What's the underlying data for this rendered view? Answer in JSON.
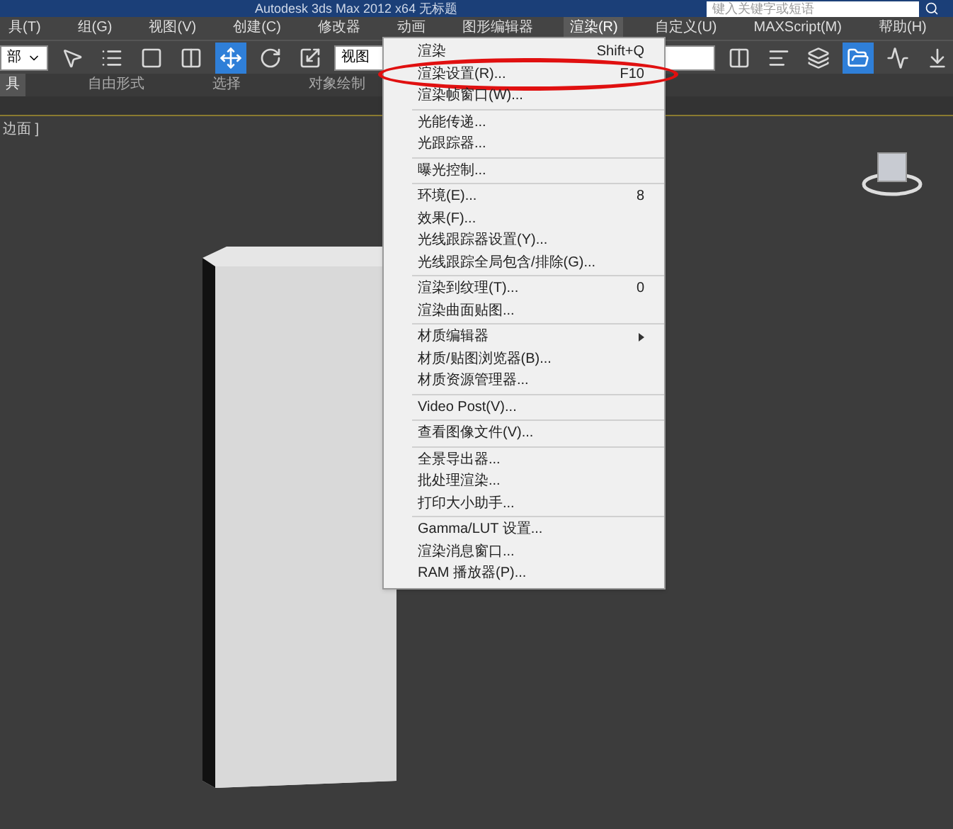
{
  "title_bar": {
    "title": "Autodesk 3ds Max  2012 x64  无标题",
    "search_placeholder": "键入关键字或短语"
  },
  "menu_bar": [
    {
      "label": "具(T)",
      "selected": false
    },
    {
      "label": "组(G)",
      "selected": false
    },
    {
      "label": "视图(V)",
      "selected": false
    },
    {
      "label": "创建(C)",
      "selected": false
    },
    {
      "label": "修改器",
      "selected": false
    },
    {
      "label": "动画",
      "selected": false
    },
    {
      "label": "图形编辑器",
      "selected": false
    },
    {
      "label": "渲染(R)",
      "selected": true
    },
    {
      "label": "自定义(U)",
      "selected": false
    },
    {
      "label": "MAXScript(M)",
      "selected": false
    },
    {
      "label": "帮助(H)",
      "selected": false
    }
  ],
  "toolbar": {
    "selection_filter": "部",
    "reference_coordinate": "视图"
  },
  "ribbon_tabs": [
    {
      "label": "具",
      "selected": true
    },
    {
      "label": "自由形式",
      "selected": false
    },
    {
      "label": "选择",
      "selected": false
    },
    {
      "label": "对象绘制",
      "selected": false
    }
  ],
  "viewport": {
    "label": "边面 ]"
  },
  "render_menu": [
    [
      {
        "label": "渲染",
        "shortcut": "Shift+Q",
        "submenu": false,
        "circled": false
      },
      {
        "label": "渲染设置(R)...",
        "shortcut": "F10",
        "submenu": false,
        "circled": true
      },
      {
        "label": "渲染帧窗口(W)...",
        "submenu": false,
        "circled": false
      }
    ],
    [
      {
        "label": "光能传递...",
        "submenu": false,
        "circled": false
      },
      {
        "label": "光跟踪器...",
        "submenu": false,
        "circled": false
      }
    ],
    [
      {
        "label": "曝光控制...",
        "submenu": false,
        "circled": false
      }
    ],
    [
      {
        "label": "环境(E)...",
        "shortcut": "8",
        "submenu": false,
        "circled": false
      },
      {
        "label": "效果(F)...",
        "submenu": false,
        "circled": false
      },
      {
        "label": "光线跟踪器设置(Y)...",
        "submenu": false,
        "circled": false
      },
      {
        "label": "光线跟踪全局包含/排除(G)...",
        "submenu": false,
        "circled": false
      }
    ],
    [
      {
        "label": "渲染到纹理(T)...",
        "shortcut": "0",
        "submenu": false,
        "circled": false
      },
      {
        "label": "渲染曲面贴图...",
        "submenu": false,
        "circled": false
      }
    ],
    [
      {
        "label": "材质编辑器",
        "submenu": true,
        "circled": false
      },
      {
        "label": "材质/贴图浏览器(B)...",
        "submenu": false,
        "circled": false
      },
      {
        "label": "材质资源管理器...",
        "submenu": false,
        "circled": false
      }
    ],
    [
      {
        "label": "Video Post(V)...",
        "submenu": false,
        "circled": false
      }
    ],
    [
      {
        "label": "查看图像文件(V)...",
        "submenu": false,
        "circled": false
      }
    ],
    [
      {
        "label": "全景导出器...",
        "submenu": false,
        "circled": false
      },
      {
        "label": "批处理渲染...",
        "submenu": false,
        "circled": false
      },
      {
        "label": "打印大小助手...",
        "submenu": false,
        "circled": false
      }
    ],
    [
      {
        "label": "Gamma/LUT 设置...",
        "submenu": false,
        "circled": false
      },
      {
        "label": "渲染消息窗口...",
        "submenu": false,
        "circled": false
      },
      {
        "label": "RAM 播放器(P)...",
        "submenu": false,
        "circled": false
      }
    ]
  ]
}
